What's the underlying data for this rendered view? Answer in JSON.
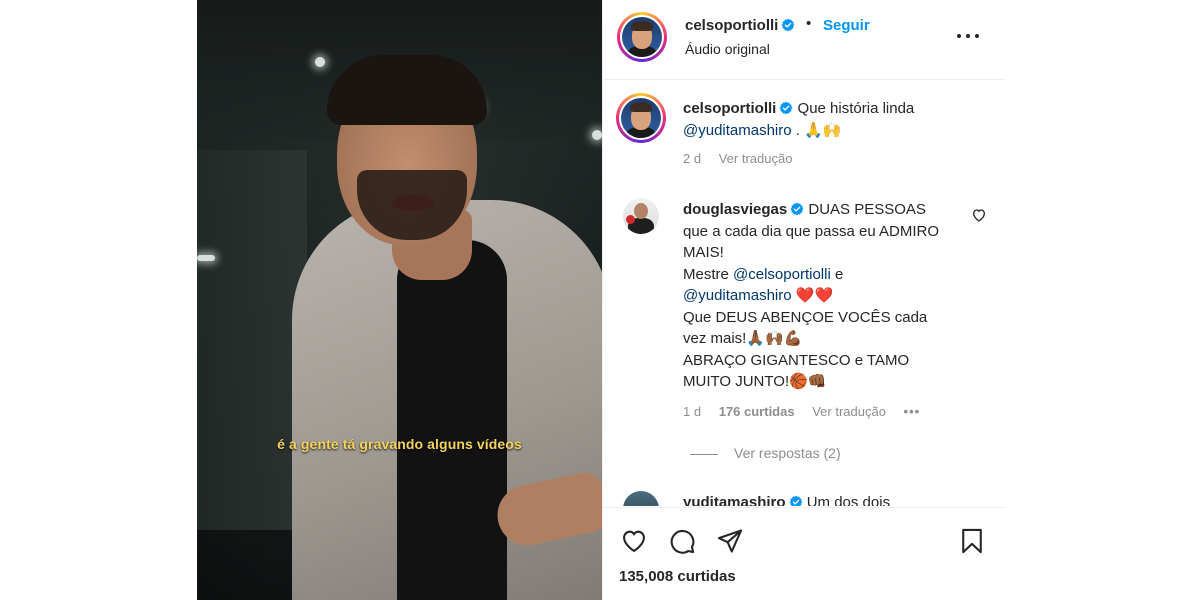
{
  "video": {
    "subtitle": "é a gente tá gravando alguns vídeos"
  },
  "post": {
    "author": "celsoportiolli",
    "verified": true,
    "follow_label": "Seguir",
    "separator": "•",
    "audio_label": "Áudio original",
    "more_icon": "more-horizontal-icon"
  },
  "comments": [
    {
      "username": "celsoportiolli",
      "text": "Que história linda",
      "mention": "@yuditamashiro",
      "suffix": ". 🙏🙌",
      "time": "2 d",
      "translate": "Ver tradução"
    },
    {
      "username": "douglasviegas",
      "text_1": "DUAS PESSOAS que a cada dia que passa eu ADMIRO MAIS!",
      "text_2": "Mestre",
      "mention_1": "@celsoportiolli",
      "text_3": "e",
      "mention_2": "@yuditamashiro",
      "hearts": "❤️❤️",
      "text_4": "Que DEUS ABENÇOE VOCÊS cada vez mais!🙏🏾🙌🏾💪🏾",
      "text_5": "ABRAÇO GIGANTESCO e TAMO MUITO JUNTO!🏀👊🏾",
      "time": "1 d",
      "likes": "176 curtidas",
      "translate": "Ver tradução",
      "more": "•••",
      "replies": "Ver respostas (2)"
    },
    {
      "username": "yuditamashiro",
      "text": "Um dos dois"
    }
  ],
  "actions": {
    "like_icon": "heart-icon",
    "comment_icon": "comment-icon",
    "share_icon": "send-icon",
    "save_icon": "bookmark-icon"
  },
  "likes_count": "135,008 curtidas",
  "colors": {
    "link_blue": "#0095f6",
    "mention": "#00376b",
    "subtitle": "#f4d35c",
    "muted": "#8e8e8e"
  }
}
